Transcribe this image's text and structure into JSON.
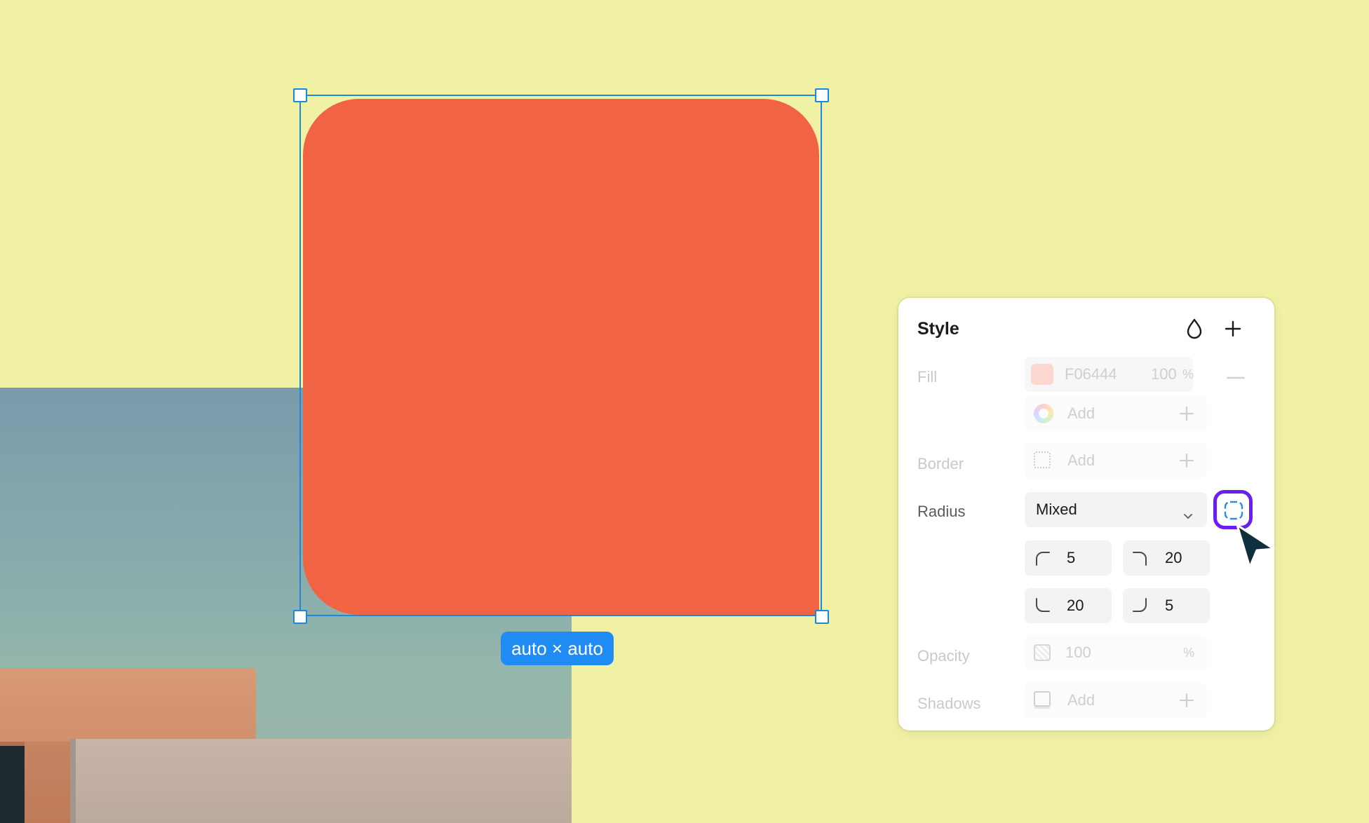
{
  "canvas": {
    "background_color": "#f1f1a6",
    "shape_fill": "#F06444",
    "size_badge": "auto × auto"
  },
  "panel": {
    "title": "Style",
    "header_icons": [
      "droplet-icon",
      "plus-icon"
    ],
    "fill": {
      "label": "Fill",
      "hex": "F06444",
      "opacity_value": "100",
      "opacity_unit": "%",
      "add_label": "Add"
    },
    "border": {
      "label": "Border",
      "add_label": "Add"
    },
    "radius": {
      "label": "Radius",
      "mode": "Mixed",
      "top_left": "5",
      "top_right": "20",
      "bottom_left": "20",
      "bottom_right": "5"
    },
    "opacity": {
      "label": "Opacity",
      "value": "100",
      "unit": "%"
    },
    "shadows": {
      "label": "Shadows",
      "add_label": "Add"
    }
  }
}
